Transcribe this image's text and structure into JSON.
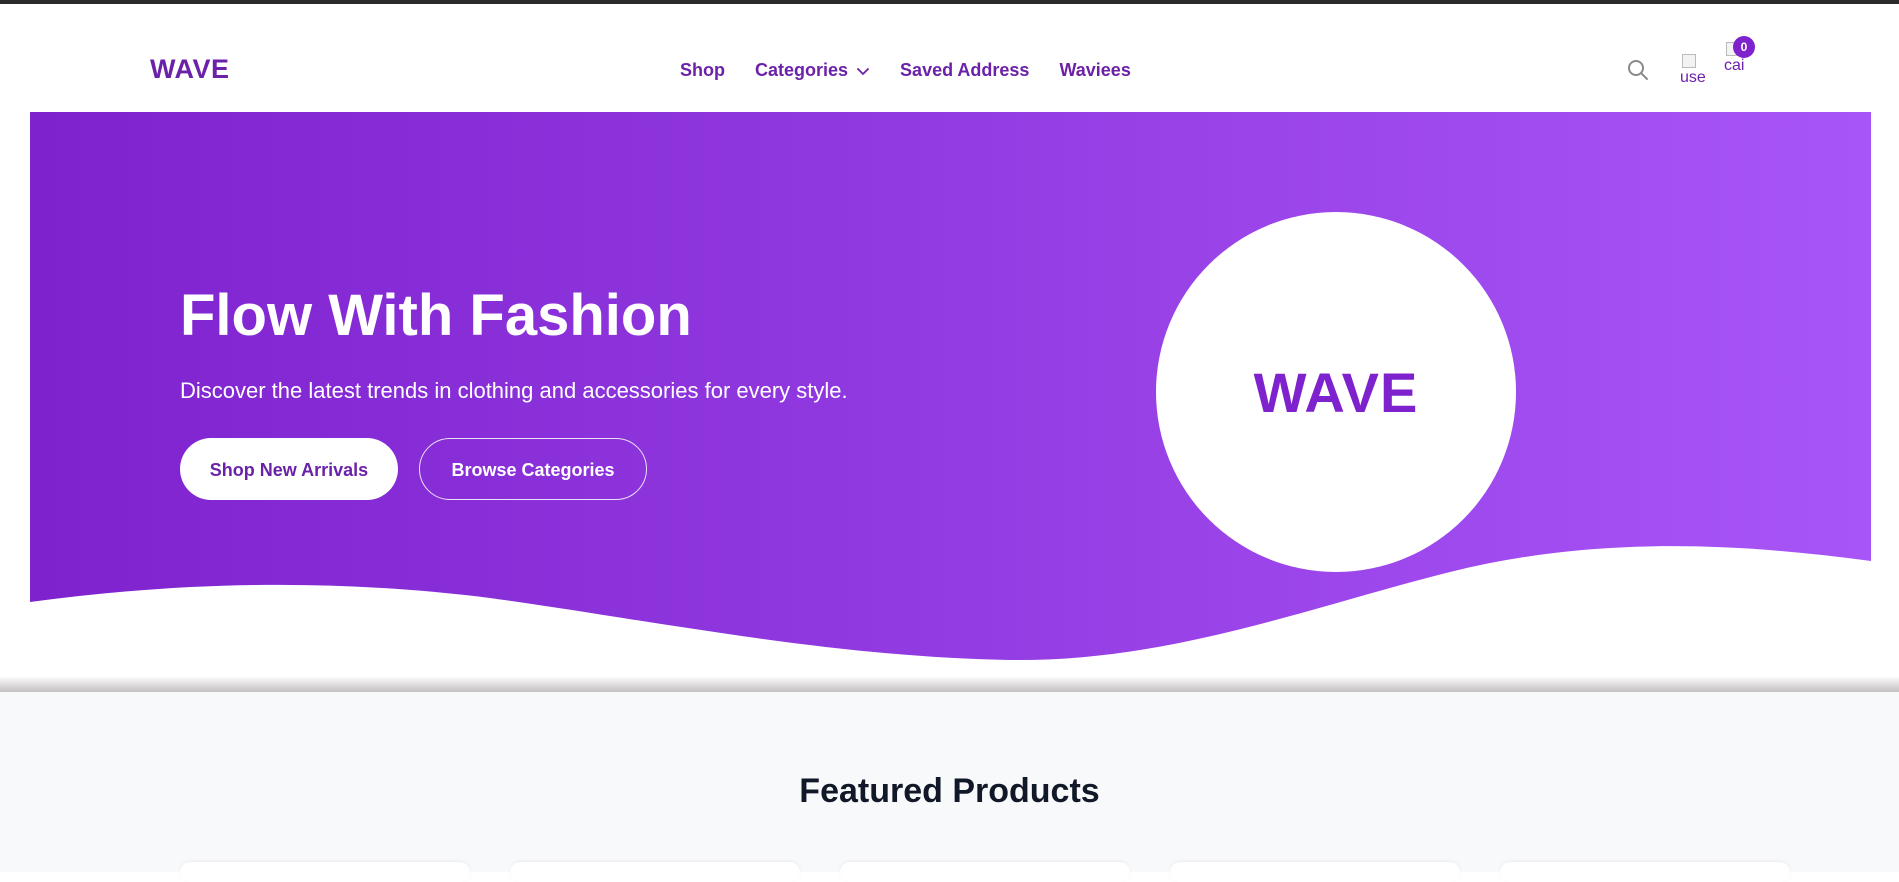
{
  "header": {
    "logo": "WAVE",
    "nav": [
      {
        "label": "Shop"
      },
      {
        "label": "Categories",
        "has_dropdown": true
      },
      {
        "label": "Saved Address"
      },
      {
        "label": "Waviees"
      }
    ],
    "user_alt": "use",
    "cart_alt": "cai",
    "cart_count": "0",
    "icons": {
      "search": "search-icon",
      "dropdown": "chevron-down-icon"
    }
  },
  "hero": {
    "title": "Flow With Fashion",
    "subtitle": "Discover the latest trends in clothing and accessories for every style.",
    "primary_button": "Shop New Arrivals",
    "secondary_button": "Browse Categories",
    "circle_text": "WAVE"
  },
  "featured": {
    "title": "Featured Products"
  },
  "colors": {
    "brand": "#6b21a8",
    "gradient_start": "#7e22ce",
    "gradient_end": "#a855f7",
    "text_dark": "#111827"
  }
}
